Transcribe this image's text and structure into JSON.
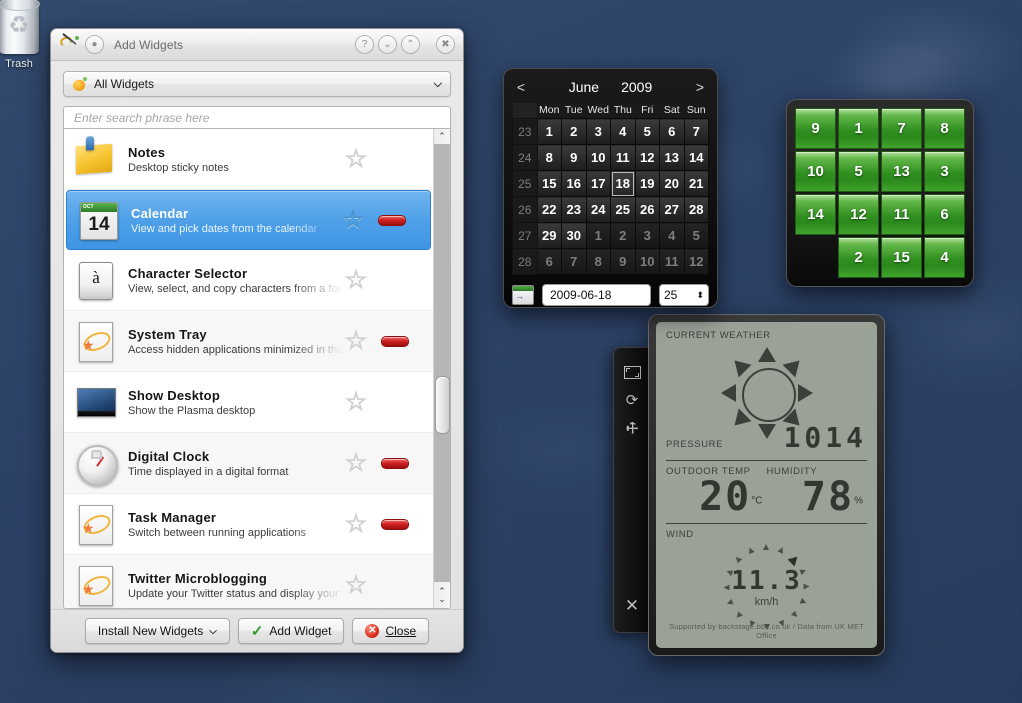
{
  "desktop": {
    "background_color": "#2a4367",
    "icons": [
      {
        "name": "trash-icon",
        "label": "Trash"
      }
    ]
  },
  "add_widgets_dialog": {
    "title": "Add Widgets",
    "titlebar_buttons": [
      {
        "name": "help-button",
        "glyph": "?"
      },
      {
        "name": "shade-down-button",
        "glyph": "⌄"
      },
      {
        "name": "shade-up-button",
        "glyph": "⌃"
      },
      {
        "name": "close-button",
        "glyph": "✖"
      }
    ],
    "category": {
      "selected": "All Widgets",
      "arrow": "⌵",
      "options": [
        "All Widgets"
      ]
    },
    "search": {
      "value": "",
      "placeholder": "Enter search phrase here"
    },
    "widgets": [
      {
        "name": "Notes",
        "description": "Desktop sticky notes",
        "icon": "notes-icon",
        "favorite": false,
        "removable": false,
        "selected": false
      },
      {
        "name": "Calendar",
        "description": "View and pick dates from the calendar",
        "icon": "calendar-icon",
        "icon_day": "14",
        "icon_month": "OCT",
        "favorite": false,
        "removable": true,
        "selected": true
      },
      {
        "name": "Character Selector",
        "description": "View, select, and copy characters from a font collection",
        "icon": "character-icon",
        "icon_glyph": "à",
        "favorite": false,
        "removable": false,
        "selected": false
      },
      {
        "name": "System Tray",
        "description": "Access hidden applications minimized in the system tray",
        "icon": "plasma-generic-icon",
        "favorite": false,
        "removable": true,
        "selected": false
      },
      {
        "name": "Show Desktop",
        "description": "Show the Plasma desktop",
        "icon": "show-desktop-icon",
        "favorite": false,
        "removable": false,
        "selected": false
      },
      {
        "name": "Digital Clock",
        "description": "Time displayed in a digital format",
        "icon": "clock-icon",
        "favorite": false,
        "removable": true,
        "selected": false
      },
      {
        "name": "Task Manager",
        "description": "Switch between running applications",
        "icon": "plasma-generic-icon",
        "favorite": false,
        "removable": true,
        "selected": false
      },
      {
        "name": "Twitter Microblogging",
        "description": "Update your Twitter status and display your timeline",
        "icon": "plasma-generic-icon",
        "favorite": false,
        "removable": false,
        "selected": false
      }
    ],
    "scrollbar": {
      "up_arrow": "⌃",
      "down_arrow": "⌄"
    },
    "footer_buttons": {
      "install": "Install New Widgets",
      "install_arrow": "⌵",
      "add": "Add Widget",
      "close": "Close",
      "close_accel": "C"
    }
  },
  "calendar_widget": {
    "prev": "<",
    "next": ">",
    "month": "June",
    "year": "2009",
    "day_headers": [
      "Mon",
      "Tue",
      "Wed",
      "Thu",
      "Fri",
      "Sat",
      "Sun"
    ],
    "weeks": [
      {
        "number": "23",
        "days": [
          {
            "d": "1",
            "out": false
          },
          {
            "d": "2",
            "out": false
          },
          {
            "d": "3",
            "out": false
          },
          {
            "d": "4",
            "out": false
          },
          {
            "d": "5",
            "out": false
          },
          {
            "d": "6",
            "out": false
          },
          {
            "d": "7",
            "out": false
          }
        ]
      },
      {
        "number": "24",
        "days": [
          {
            "d": "8",
            "out": false
          },
          {
            "d": "9",
            "out": false
          },
          {
            "d": "10",
            "out": false
          },
          {
            "d": "11",
            "out": false
          },
          {
            "d": "12",
            "out": false
          },
          {
            "d": "13",
            "out": false
          },
          {
            "d": "14",
            "out": false
          }
        ]
      },
      {
        "number": "25",
        "days": [
          {
            "d": "15",
            "out": false
          },
          {
            "d": "16",
            "out": false
          },
          {
            "d": "17",
            "out": false
          },
          {
            "d": "18",
            "out": false,
            "today": true
          },
          {
            "d": "19",
            "out": false
          },
          {
            "d": "20",
            "out": false
          },
          {
            "d": "21",
            "out": false
          }
        ]
      },
      {
        "number": "26",
        "days": [
          {
            "d": "22",
            "out": false
          },
          {
            "d": "23",
            "out": false
          },
          {
            "d": "24",
            "out": false
          },
          {
            "d": "25",
            "out": false
          },
          {
            "d": "26",
            "out": false
          },
          {
            "d": "27",
            "out": false
          },
          {
            "d": "28",
            "out": false
          }
        ]
      },
      {
        "number": "27",
        "days": [
          {
            "d": "29",
            "out": false
          },
          {
            "d": "30",
            "out": false
          },
          {
            "d": "1",
            "out": true
          },
          {
            "d": "2",
            "out": true
          },
          {
            "d": "3",
            "out": true
          },
          {
            "d": "4",
            "out": true
          },
          {
            "d": "5",
            "out": true
          }
        ]
      },
      {
        "number": "28",
        "days": [
          {
            "d": "6",
            "out": true
          },
          {
            "d": "7",
            "out": true
          },
          {
            "d": "8",
            "out": true
          },
          {
            "d": "9",
            "out": true
          },
          {
            "d": "10",
            "out": true
          },
          {
            "d": "11",
            "out": true
          },
          {
            "d": "12",
            "out": true
          }
        ]
      }
    ],
    "date_value": "2009-06-18",
    "week_value": "25",
    "spin_arrows": "⬍"
  },
  "puzzle_widget": {
    "rows": [
      [
        "9",
        "1",
        "7",
        "8"
      ],
      [
        "10",
        "5",
        "13",
        "3"
      ],
      [
        "14",
        "12",
        "11",
        "6"
      ],
      [
        "",
        "2",
        "15",
        "4"
      ]
    ],
    "tile_color": "#2f8f1f"
  },
  "weather_widget": {
    "title": "CURRENT WEATHER",
    "condition_icon": "sun-icon",
    "pressure_label": "PRESSURE",
    "pressure_value": "1014",
    "outdoor_temp_label": "OUTDOOR TEMP",
    "outdoor_temp_value": "20",
    "outdoor_temp_unit": "°C",
    "humidity_label": "HUMIDITY",
    "humidity_value": "78",
    "humidity_unit": "%",
    "wind_label": "WIND",
    "wind_value": "11.3",
    "wind_unit": "km/h",
    "attribution": "Supported by backstage.bbc.co.uk / Data from UK MET Office"
  },
  "widget_handle": {
    "buttons": [
      {
        "name": "resize-handle",
        "glyph": ""
      },
      {
        "name": "rotate-icon",
        "glyph": "⟳"
      },
      {
        "name": "configure-wrench-icon",
        "glyph": "⚒"
      },
      {
        "name": "close-widget-icon",
        "glyph": "✕"
      }
    ]
  }
}
